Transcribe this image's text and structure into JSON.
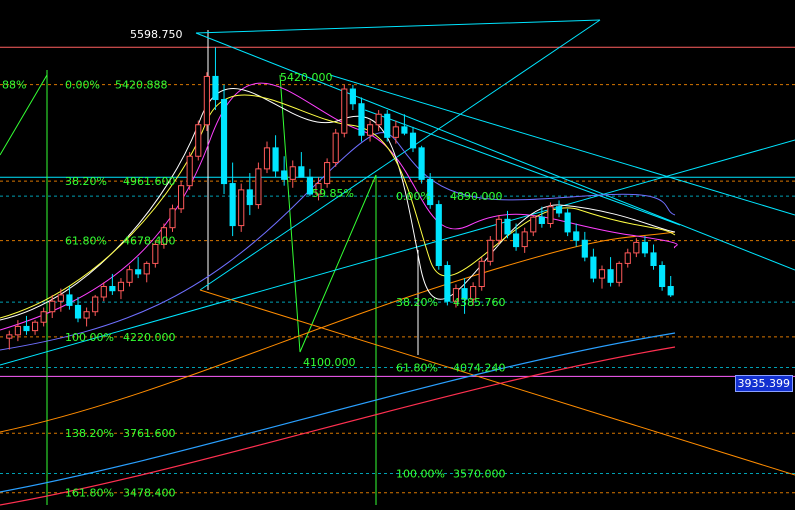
{
  "chart_data": {
    "type": "candlestick",
    "ylim": [
      3420,
      5800
    ],
    "grid": false,
    "price_label": "3935.399",
    "peak_label": "5598.750",
    "fib_left": [
      {
        "pct": "0.00%",
        "price": "5420.888",
        "value": 5420.888,
        "pct_only": "88%"
      },
      {
        "pct": "38.20%",
        "price": "4961.600",
        "value": 4961.6
      },
      {
        "pct": "61.80%",
        "price": "4678.400",
        "value": 4678.4
      },
      {
        "pct": "100.00%",
        "price": "4220.000",
        "value": 4220.0
      },
      {
        "pct": "138.20%",
        "price": "3761.600",
        "value": 3761.6
      },
      {
        "pct": "161.80%",
        "price": "3478.400",
        "value": 3478.4
      }
    ],
    "fib_right": [
      {
        "pct": "0.00%",
        "price": "4890.000",
        "value": 4890.0
      },
      {
        "pct": "38.20%",
        "price": "4385.760",
        "value": 4385.76
      },
      {
        "pct": "61.80%",
        "price": "4074.240",
        "value": 4074.24
      },
      {
        "pct": "100.00%",
        "price": "3570.000",
        "value": 3570.0
      }
    ],
    "mid_labels": {
      "high2": "5420.000",
      "low1": "4100.000",
      "fan": "59.85%"
    },
    "candles": [
      [
        4214,
        4250,
        4160,
        4230
      ],
      [
        4230,
        4300,
        4200,
        4270
      ],
      [
        4270,
        4320,
        4230,
        4250
      ],
      [
        4250,
        4300,
        4230,
        4290
      ],
      [
        4290,
        4360,
        4270,
        4340
      ],
      [
        4340,
        4420,
        4310,
        4390
      ],
      [
        4390,
        4450,
        4340,
        4420
      ],
      [
        4420,
        4460,
        4350,
        4370
      ],
      [
        4370,
        4410,
        4290,
        4310
      ],
      [
        4310,
        4360,
        4270,
        4340
      ],
      [
        4340,
        4420,
        4320,
        4410
      ],
      [
        4410,
        4480,
        4390,
        4460
      ],
      [
        4460,
        4520,
        4420,
        4440
      ],
      [
        4440,
        4500,
        4400,
        4480
      ],
      [
        4480,
        4560,
        4460,
        4540
      ],
      [
        4540,
        4600,
        4500,
        4520
      ],
      [
        4520,
        4580,
        4480,
        4570
      ],
      [
        4570,
        4680,
        4550,
        4660
      ],
      [
        4660,
        4760,
        4640,
        4740
      ],
      [
        4740,
        4850,
        4720,
        4830
      ],
      [
        4830,
        4960,
        4810,
        4940
      ],
      [
        4940,
        5100,
        4920,
        5080
      ],
      [
        5080,
        5250,
        5060,
        5230
      ],
      [
        5230,
        5480,
        5200,
        5460
      ],
      [
        5460,
        5598,
        5300,
        5350
      ],
      [
        5350,
        5420,
        4900,
        4950
      ],
      [
        4950,
        5050,
        4700,
        4750
      ],
      [
        4750,
        4950,
        4720,
        4920
      ],
      [
        4920,
        5000,
        4800,
        4850
      ],
      [
        4850,
        5050,
        4830,
        5020
      ],
      [
        5020,
        5150,
        5000,
        5120
      ],
      [
        5120,
        5180,
        4980,
        5010
      ],
      [
        5010,
        5080,
        4940,
        4970
      ],
      [
        4970,
        5060,
        4930,
        5030
      ],
      [
        5030,
        5100,
        4990,
        4980
      ],
      [
        4980,
        5020,
        4890,
        4900
      ],
      [
        4900,
        4980,
        4870,
        4950
      ],
      [
        4950,
        5070,
        4930,
        5050
      ],
      [
        5050,
        5210,
        5030,
        5190
      ],
      [
        5190,
        5420,
        5170,
        5400
      ],
      [
        5400,
        5420,
        5300,
        5330
      ],
      [
        5330,
        5360,
        5150,
        5180
      ],
      [
        5180,
        5250,
        5150,
        5230
      ],
      [
        5230,
        5300,
        5200,
        5280
      ],
      [
        5280,
        5300,
        5150,
        5170
      ],
      [
        5170,
        5250,
        5140,
        5220
      ],
      [
        5220,
        5280,
        5180,
        5190
      ],
      [
        5190,
        5220,
        5100,
        5120
      ],
      [
        5120,
        5130,
        4950,
        4970
      ],
      [
        4970,
        5000,
        4830,
        4850
      ],
      [
        4850,
        4870,
        4540,
        4560
      ],
      [
        4560,
        4580,
        4370,
        4390
      ],
      [
        4390,
        4470,
        4360,
        4450
      ],
      [
        4450,
        4500,
        4330,
        4400
      ],
      [
        4400,
        4480,
        4370,
        4460
      ],
      [
        4460,
        4600,
        4440,
        4580
      ],
      [
        4580,
        4700,
        4560,
        4680
      ],
      [
        4680,
        4800,
        4660,
        4780
      ],
      [
        4780,
        4820,
        4690,
        4710
      ],
      [
        4710,
        4760,
        4630,
        4650
      ],
      [
        4650,
        4740,
        4620,
        4720
      ],
      [
        4720,
        4800,
        4700,
        4790
      ],
      [
        4790,
        4840,
        4740,
        4760
      ],
      [
        4760,
        4860,
        4740,
        4840
      ],
      [
        4840,
        4870,
        4790,
        4810
      ],
      [
        4810,
        4830,
        4700,
        4720
      ],
      [
        4720,
        4760,
        4650,
        4680
      ],
      [
        4680,
        4720,
        4580,
        4600
      ],
      [
        4600,
        4640,
        4480,
        4500
      ],
      [
        4500,
        4560,
        4450,
        4540
      ],
      [
        4540,
        4600,
        4460,
        4480
      ],
      [
        4480,
        4580,
        4460,
        4570
      ],
      [
        4570,
        4640,
        4550,
        4620
      ],
      [
        4620,
        4690,
        4600,
        4670
      ],
      [
        4670,
        4700,
        4600,
        4620
      ],
      [
        4620,
        4660,
        4540,
        4560
      ],
      [
        4560,
        4580,
        4440,
        4460
      ],
      [
        4460,
        4510,
        4410,
        4420
      ]
    ]
  }
}
